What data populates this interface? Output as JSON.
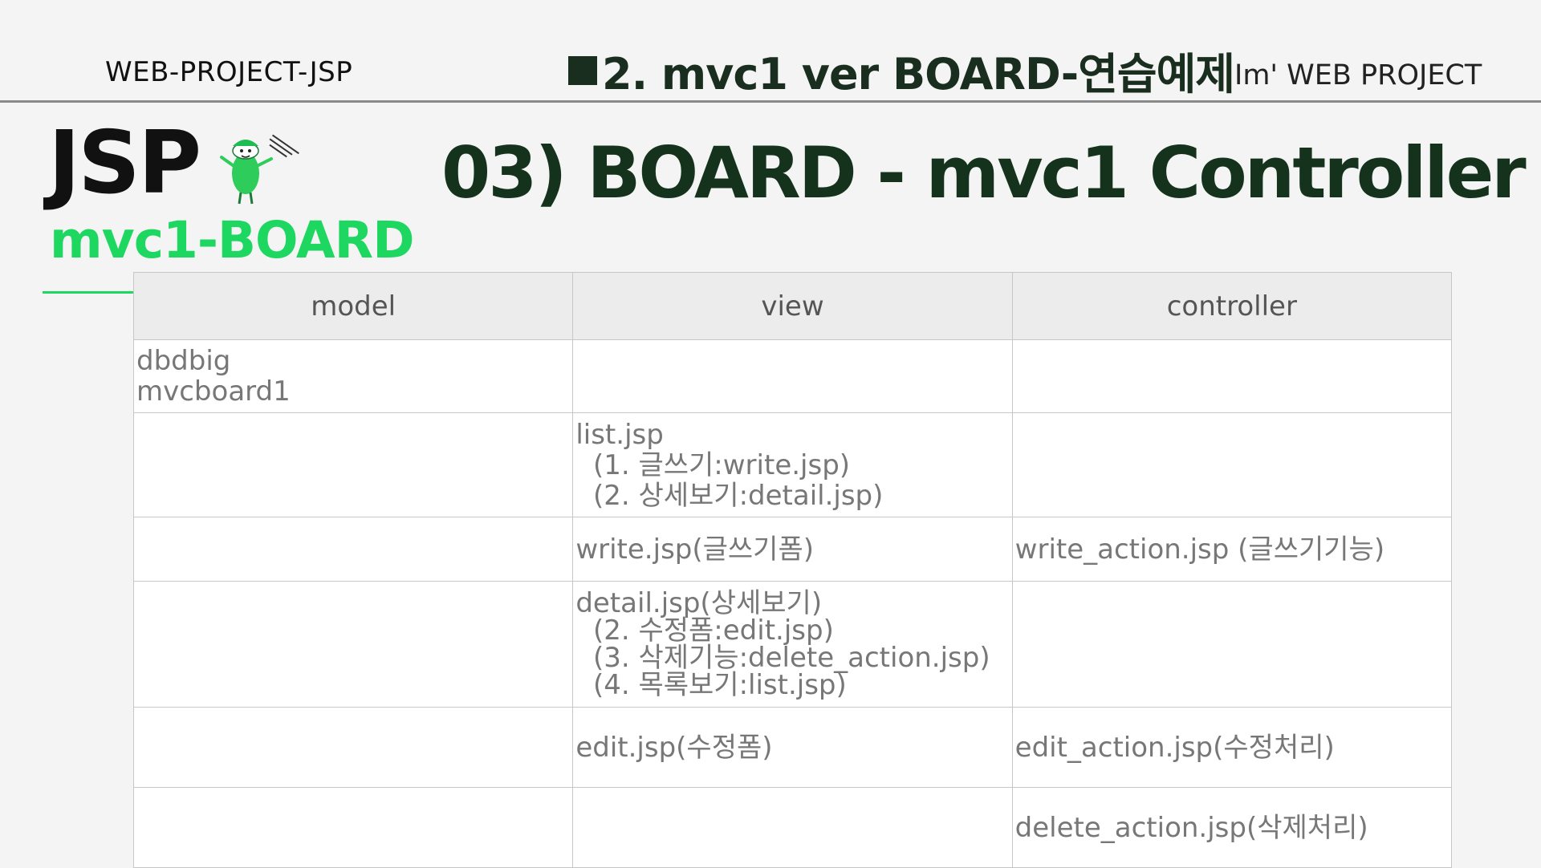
{
  "header": {
    "left": "WEB-PROJECT-JSP",
    "center": "2. mvc1 ver  BOARD-연습예제",
    "right": "Im'  WEB PROJECT"
  },
  "logo": {
    "text": "JSP",
    "subtitle": "mvc1-BOARD"
  },
  "slide_title": "03) BOARD - mvc1  Controller",
  "table": {
    "headers": [
      "model",
      "view",
      "controller"
    ],
    "rows": [
      {
        "model": "dbdbig\nmvcboard1",
        "view": "",
        "controller": ""
      },
      {
        "model": "",
        "view": "list.jsp\n  (1. 글쓰기:write.jsp)\n  (2. 상세보기:detail.jsp)",
        "controller": ""
      },
      {
        "model": "",
        "view": "write.jsp(글쓰기폼)",
        "controller": "write_action.jsp (글쓰기기능)"
      },
      {
        "model": "",
        "view": "detail.jsp(상세보기)\n  (2. 수정폼:edit.jsp)\n  (3. 삭제기능:delete_action.jsp)\n  (4. 목록보기:list.jsp)",
        "controller": ""
      },
      {
        "model": "",
        "view": "edit.jsp(수정폼)",
        "controller": "edit_action.jsp(수정처리)"
      },
      {
        "model": "",
        "view": "",
        "controller": "delete_action.jsp(삭제처리)"
      }
    ]
  },
  "colors": {
    "accent_green": "#1ed760",
    "title_dark_green": "#15331c",
    "table_header_bg": "#ececec"
  }
}
